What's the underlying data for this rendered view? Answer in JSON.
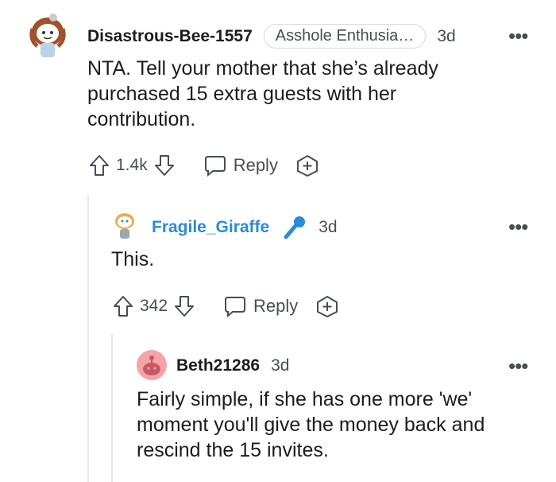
{
  "comments": [
    {
      "username": "Disastrous-Bee-1557",
      "flair": "Asshole Enthusia…",
      "time": "3d",
      "more": "•••",
      "body": "NTA. Tell your mother that she’s already purchased 15 extra guests with her contribution.",
      "score": "1.4k",
      "reply_label": "Reply"
    },
    {
      "username": "Fragile_Giraffe",
      "time": "3d",
      "more": "•••",
      "body": "This.",
      "score": "342",
      "reply_label": "Reply"
    },
    {
      "username": "Beth21286",
      "time": "3d",
      "more": "•••",
      "body": "Fairly simple, if she has one more 'we' moment you'll give the money back and rescind the 15 invites."
    }
  ],
  "colors": {
    "op_username": "#2a8bd8",
    "mic_icon": "#2a8bd8",
    "avatar_pink": "#f4a3a8"
  },
  "icons": [
    "snoo-avatar-icon",
    "upvote-icon",
    "downvote-icon",
    "comment-bubble-icon",
    "award-plus-icon",
    "microphone-icon",
    "more-options-icon"
  ]
}
